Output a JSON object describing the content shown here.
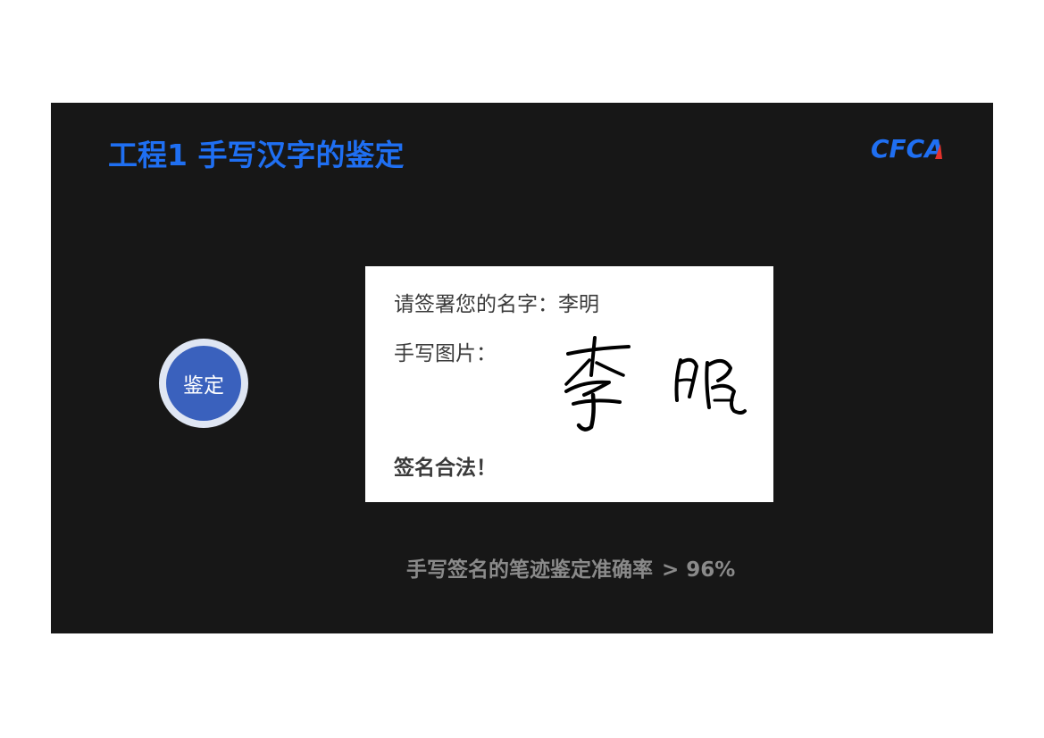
{
  "slide": {
    "title": "工程1 手写汉字的鉴定",
    "logo_text": "CFCA",
    "accent_color": "#1f6ff2"
  },
  "verify_button": {
    "label": "鉴定",
    "color": "#3a61bd"
  },
  "card": {
    "prompt": "请签署您的名字：李明",
    "handwriting_label": "手写图片：",
    "signature_name": "李明",
    "result": "签名合法！"
  },
  "accuracy": {
    "label": "手写签名的笔迹鉴定准确率",
    "value": "> 96%"
  }
}
